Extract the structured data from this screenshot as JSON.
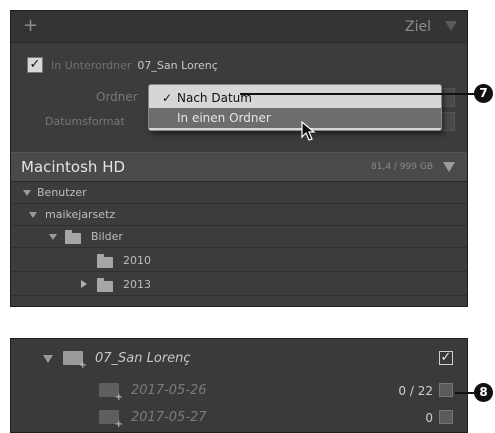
{
  "panel": {
    "plus_glyph": "+",
    "title": "Ziel",
    "subfolder": {
      "checkbox_glyph": "✓",
      "label": "In Unterordner",
      "value": "07_San Lorenç"
    },
    "ordner_label": "Ordner",
    "datumsformat_label": "Datumsformat",
    "dropdown": {
      "items": [
        {
          "label": "Nach Datum",
          "checked": true
        },
        {
          "label": "In einen Ordner",
          "checked": false
        }
      ],
      "check_glyph": "✓"
    },
    "volume": {
      "name": "Macintosh HD",
      "size": "81,4 / 999 GB"
    },
    "tree": [
      {
        "label": "Benutzer",
        "indent": 0
      },
      {
        "label": "maikejarsetz",
        "indent": 1
      },
      {
        "label": "Bilder",
        "indent": 2
      },
      {
        "label": "2010",
        "indent": 3
      },
      {
        "label": "2013",
        "indent": 3
      }
    ]
  },
  "callouts": {
    "first": "7",
    "second": "8"
  },
  "panel2": {
    "root": {
      "name": "07_San Lorenç",
      "check_glyph": "✓"
    },
    "rows": [
      {
        "name": "2017-05-26",
        "count": "0 / 22"
      },
      {
        "name": "2017-05-27",
        "count": "0"
      }
    ]
  },
  "colors": {
    "panel_bg": "#3c3c3c",
    "popup_bg": "#d6d6d6",
    "highlight": "#6d6d6d"
  }
}
